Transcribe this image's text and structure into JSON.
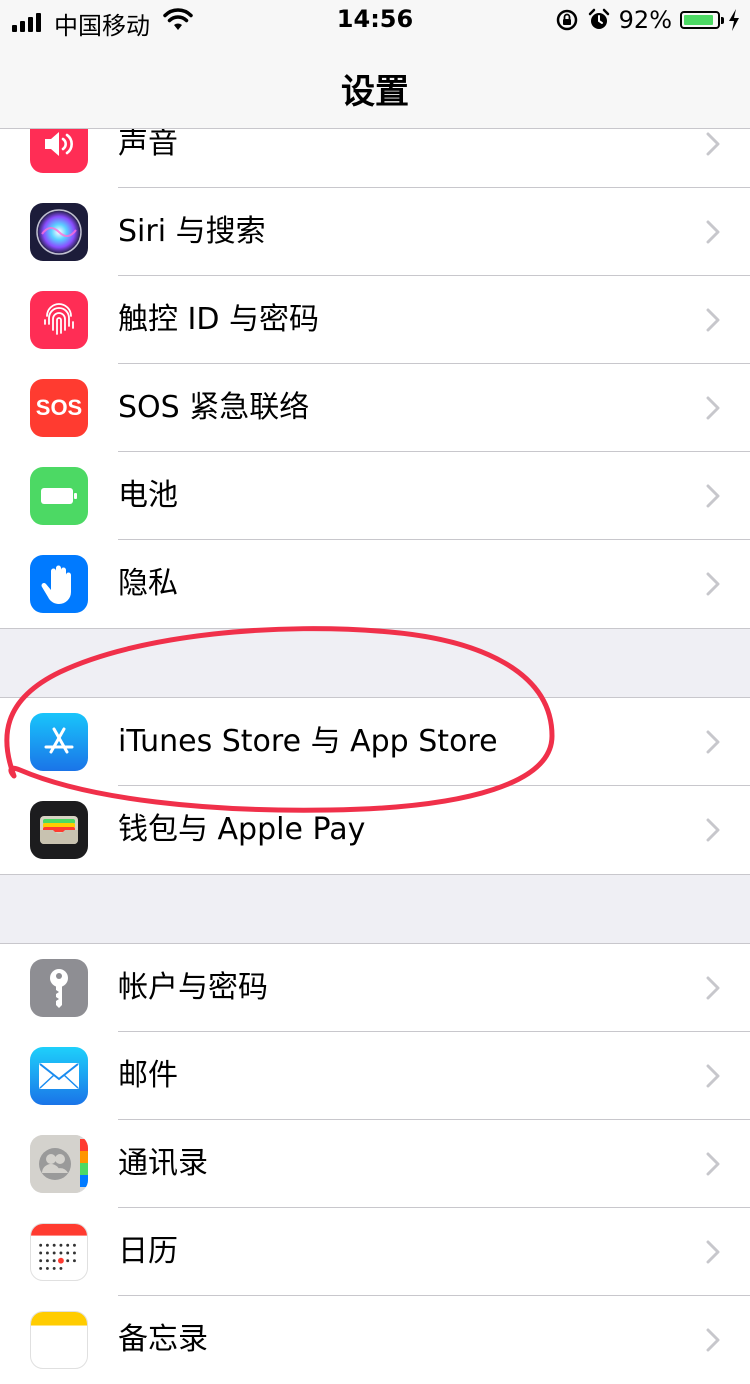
{
  "status_bar": {
    "carrier": "中国移动",
    "time": "14:56",
    "battery_percent": "92%",
    "battery_level": 0.92
  },
  "nav": {
    "title": "设置"
  },
  "groups": [
    {
      "items": [
        {
          "label": "声音",
          "icon": "speaker-icon",
          "color": "#ff2d55"
        },
        {
          "label": "Siri 与搜索",
          "icon": "siri-icon",
          "color": "#1c1c3a"
        },
        {
          "label": "触控 ID 与密码",
          "icon": "fingerprint-icon",
          "color": "#ff2d55"
        },
        {
          "label": "SOS 紧急联络",
          "icon": "sos-icon",
          "color": "#ff3b30",
          "icon_text": "SOS"
        },
        {
          "label": "电池",
          "icon": "battery-icon",
          "color": "#4cd964"
        },
        {
          "label": "隐私",
          "icon": "hand-icon",
          "color": "#007aff"
        }
      ]
    },
    {
      "items": [
        {
          "label": "iTunes Store 与 App Store",
          "icon": "app-store-icon",
          "color": "#1e9bf6"
        },
        {
          "label": "钱包与 Apple Pay",
          "icon": "wallet-icon",
          "color": "#1c1c1e"
        }
      ]
    },
    {
      "items": [
        {
          "label": "帐户与密码",
          "icon": "key-icon",
          "color": "#8e8e93"
        },
        {
          "label": "邮件",
          "icon": "mail-icon",
          "color": "#1a8cf0"
        },
        {
          "label": "通讯录",
          "icon": "contacts-icon",
          "color": "#d8d8d8"
        },
        {
          "label": "日历",
          "icon": "calendar-icon",
          "color": "#ffffff"
        },
        {
          "label": "备忘录",
          "icon": "notes-icon",
          "color": "#ffcc00"
        }
      ]
    }
  ],
  "annotation_color": "#f0304a"
}
